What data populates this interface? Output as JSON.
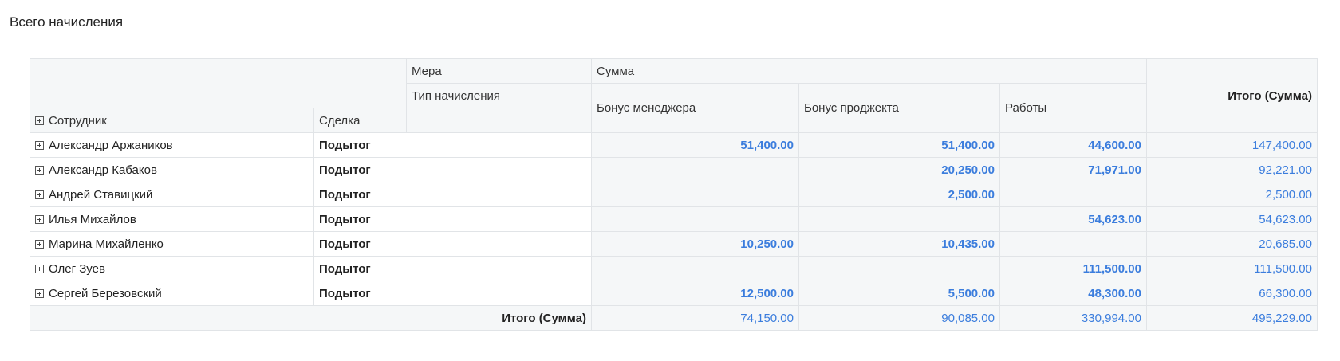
{
  "title": "Всего начисления",
  "header": {
    "measure_label": "Мера",
    "measure_value": "Сумма",
    "type_label": "Тип начисления",
    "employee_label": "Сотрудник",
    "deal_label": "Сделка",
    "columns": [
      "Бонус менеджера",
      "Бонус проджекта",
      "Работы"
    ],
    "total_label": "Итого (Сумма)"
  },
  "rows": [
    {
      "employee": "Александр Аржаников",
      "deal": "Подытог",
      "values": [
        "51,400.00",
        "51,400.00",
        "44,600.00"
      ],
      "total": "147,400.00"
    },
    {
      "employee": "Александр Кабаков",
      "deal": "Подытог",
      "values": [
        "",
        "20,250.00",
        "71,971.00"
      ],
      "total": "92,221.00"
    },
    {
      "employee": "Андрей Ставицкий",
      "deal": "Подытог",
      "values": [
        "",
        "2,500.00",
        ""
      ],
      "total": "2,500.00"
    },
    {
      "employee": "Илья Михайлов",
      "deal": "Подытог",
      "values": [
        "",
        "",
        "54,623.00"
      ],
      "total": "54,623.00"
    },
    {
      "employee": "Марина Михайленко",
      "deal": "Подытог",
      "values": [
        "10,250.00",
        "10,435.00",
        ""
      ],
      "total": "20,685.00"
    },
    {
      "employee": "Олег Зуев",
      "deal": "Подытог",
      "values": [
        "",
        "",
        "111,500.00"
      ],
      "total": "111,500.00"
    },
    {
      "employee": "Сергей Березовский",
      "deal": "Подытог",
      "values": [
        "12,500.00",
        "5,500.00",
        "48,300.00"
      ],
      "total": "66,300.00"
    }
  ],
  "grand_total": {
    "label": "Итого (Сумма)",
    "values": [
      "74,150.00",
      "90,085.00",
      "330,994.00"
    ],
    "total": "495,229.00"
  },
  "colors": {
    "accent": "#3b7ddd",
    "header_bg": "#f5f7f8",
    "border": "#e1e4e7"
  },
  "icons": {
    "expand": "plus-square-icon"
  }
}
